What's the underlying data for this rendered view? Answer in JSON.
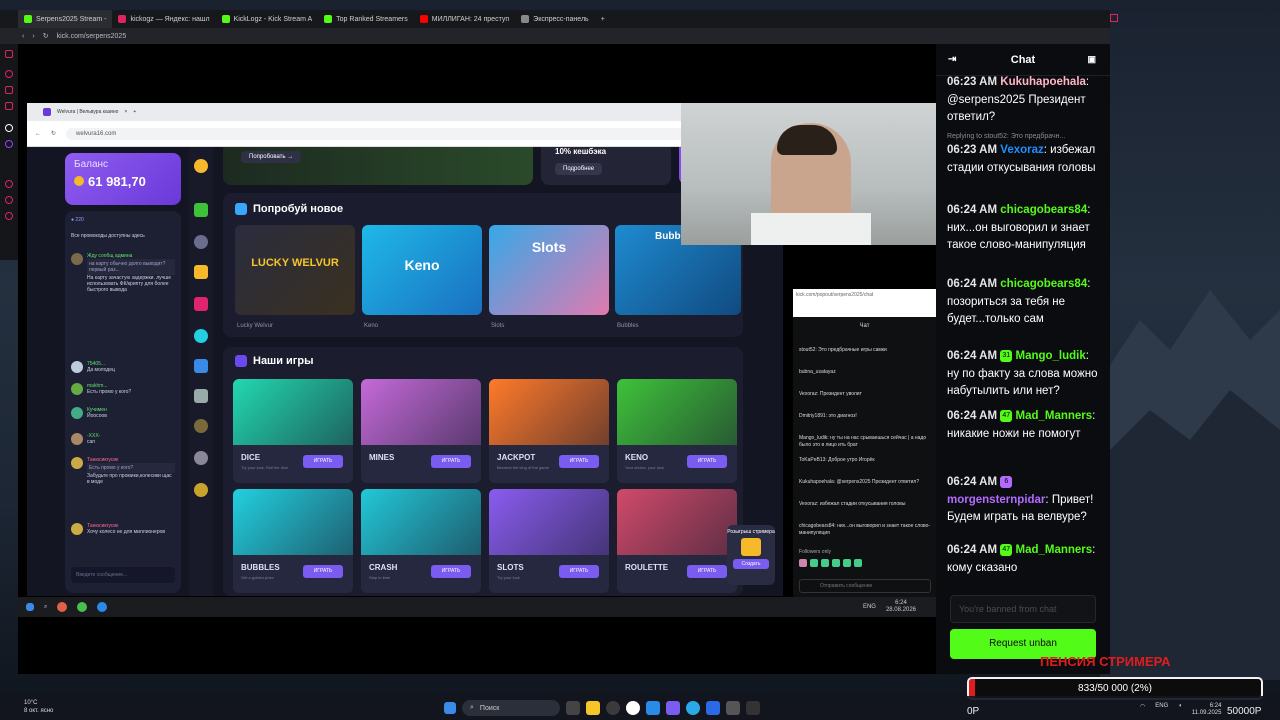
{
  "outer_browser": {
    "tabs": [
      {
        "label": "Serpens2025 Stream -",
        "color": "#53fc18",
        "active": true
      },
      {
        "label": "kickogz — Яндекс: нашл",
        "color": "#e0245e"
      },
      {
        "label": "KickLogz - Kick Stream A",
        "color": "#53fc18"
      },
      {
        "label": "Top Ranked Streamers",
        "color": "#53fc18"
      },
      {
        "label": "МИЛЛИГАН: 24 преступ",
        "color": "#ff0000"
      },
      {
        "label": "Экспресс-панель",
        "color": "#888888"
      }
    ],
    "url": "kick.com/serpens2025"
  },
  "captured": {
    "tab_label": "Welvura | Вельвура казино",
    "url": "welvura16.com",
    "balance_label": "Баланс",
    "balance_value": "61 981,70",
    "banner_button": "Попробовать",
    "cashback": "10% кешбэка",
    "more": "Подробнее",
    "left_chat": {
      "online": "220",
      "pinned": "Все промокоды доступны здесь",
      "messages": [
        {
          "name": "Жду сообщ админа",
          "reply": "на карту обычно долго выводит? первый раз...",
          "text": "На карту зачастую задержки. лучше использовать ФК/крипту для более быстрого вывода"
        },
        {
          "name": "75405...",
          "text": "Да молодец"
        },
        {
          "name": "makhm...",
          "text": "Есть промо у кого?"
        },
        {
          "name": "Кучимен",
          "text": "Йоосоов"
        },
        {
          "name": "-ХХХ-",
          "text": "сап"
        },
        {
          "name": "Танюсикгусик",
          "reply": "Есть промо у кого?",
          "text": "Забудьте про промики,колесики щас в моде"
        },
        {
          "name": "Танюсикгусик",
          "text": "Хочу колесо не для миллионеров"
        }
      ],
      "input_placeholder": "Введите сообщение..."
    },
    "try_new_title": "Попробуй новое",
    "try_new": [
      {
        "title": "LUCKY WELVUR",
        "caption": "Lucky Welvur",
        "color": "#2a2c3e"
      },
      {
        "title": "Keno",
        "caption": "Keno",
        "color": "#1fb8e8"
      },
      {
        "title": "Slots",
        "caption": "Slots",
        "color": "#36a8e8"
      },
      {
        "title": "Bubbl",
        "caption": "Bubbles",
        "color": "#1e8bd0"
      }
    ],
    "our_games_title": "Наши игры",
    "games": [
      {
        "name": "DICE",
        "sub": "Try your luck. Roll the dice",
        "btn": "ИГРАТЬ",
        "color": "#22d8b0"
      },
      {
        "name": "MINES",
        "sub": "",
        "btn": "ИГРАТЬ",
        "color": "#c46ad8"
      },
      {
        "name": "JACKPOT",
        "sub": "Become the king of the game",
        "btn": "ИГРАТЬ",
        "color": "#ff7a2a"
      },
      {
        "name": "KENO",
        "sub": "Your choice, your luck",
        "btn": "ИГРАТЬ",
        "color": "#3ec23a"
      },
      {
        "name": "BUBBLES",
        "sub": "Get a golden prize",
        "btn": "ИГРАТЬ",
        "color": "#22d0e0"
      },
      {
        "name": "CRASH",
        "sub": "Stop in time",
        "btn": "ИГРАТЬ",
        "color": "#22c8d8"
      },
      {
        "name": "SLOTS",
        "sub": "Try your luck",
        "btn": "ИГРАТЬ",
        "color": "#8a5cf0"
      },
      {
        "name": "ROULETTE",
        "sub": "",
        "btn": "ИГРАТЬ",
        "color": "#d04a6a"
      }
    ],
    "giveaway": "Розыгрыш стримера",
    "giveaway_btn": "Создать",
    "taskbar_time": "6:24",
    "taskbar_date": "28.08.2026",
    "taskbar_lang": "ENG"
  },
  "popout_chat": {
    "url": "kick.com/popout/serpens2025/chat",
    "title": "Чат",
    "messages": [
      "stout52: Это предбрачные игры самки",
      "bubna_usatayaz",
      "Vexoraz: Президент уволит",
      "Dmitriy1891: это диагноз!",
      "Mango_ludik: ну ты на нас срываешься сейчас | а надо было это в лицо ить брат",
      "ToKaPeB13: Доброе утро Игорёк",
      "Kukuhapoehala: @serpens2025 Президент ответил?",
      "Vexoraz: избежал стадии откусывания головы",
      "chicagobears84: них...он выговорил и знает такое слово-манипуляция"
    ],
    "followers_only": "Followers only",
    "send_placeholder": "Отправить сообщение"
  },
  "chat": {
    "title": "Chat",
    "reply_hint": "Replying to stout52: Это предбрачн...",
    "messages": [
      {
        "time": "06:23 AM",
        "user": "Kukuhapoehala",
        "color": "#ffb7c5",
        "text": "@serpens2025 Президент ответил?"
      },
      {
        "time": "06:23 AM",
        "user": "Vexoraz",
        "color": "#1e90ff",
        "text": "избежал стадии откусывания головы"
      },
      {
        "time": "06:24 AM",
        "user": "chicagobears84",
        "color": "#53fc18",
        "text": "них...он выговорил и знает такое слово-манипуляция"
      },
      {
        "time": "06:24 AM",
        "user": "chicagobears84",
        "color": "#53fc18",
        "text": "позориться за тебя не будет...только сам"
      },
      {
        "time": "06:24 AM",
        "user": "Mango_ludik",
        "color": "#53fc18",
        "badge": "31",
        "text": "ну по факту за слова можно набутылить или нет?"
      },
      {
        "time": "06:24 AM",
        "user": "Mad_Manners",
        "color": "#53fc18",
        "badge": "47",
        "text": "никакие ножи не помогут"
      },
      {
        "time": "06:24 AM",
        "user": "morgensternpidar",
        "color": "#b36bff",
        "badge": "6",
        "text": "Привет! Будем играть на велвуре?"
      },
      {
        "time": "06:24 AM",
        "user": "Mad_Manners",
        "color": "#53fc18",
        "badge": "47",
        "text": "кому сказано"
      }
    ],
    "input_placeholder": "You're banned from chat",
    "unban_button": "Request unban"
  },
  "overlay": {
    "title": "ПЕНСИЯ СТРИМЕРА",
    "progress_text": "833/50 000 (2%)",
    "progress_fraction": 0.02,
    "start": "0Р",
    "target": "50000Р",
    "color": "#e01d1d"
  },
  "taskbar": {
    "temp": "10°C",
    "weather": "8 окт. ясно",
    "search": "Поиск",
    "lang": "ENG",
    "time": "6:24",
    "date": "11.09.2025"
  }
}
